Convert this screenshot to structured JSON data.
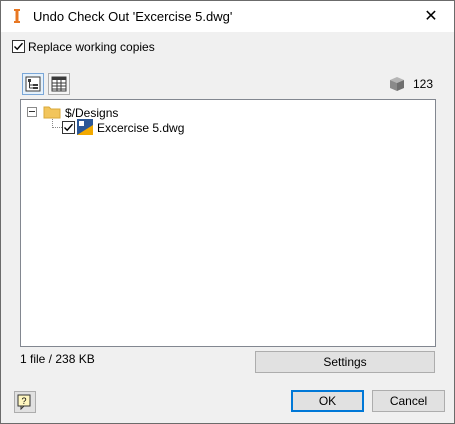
{
  "window": {
    "title": "Undo Check Out 'Excercise 5.dwg'",
    "app_icon": "inventor-vault-icon",
    "close_glyph": "✕"
  },
  "options": {
    "replace_working_copies": {
      "label": "Replace working copies",
      "checked": true
    }
  },
  "toolbar": {
    "tree_view_icon": "tree-view-icon",
    "grid_view_icon": "grid-view-icon",
    "cube_icon": "cube-icon",
    "count": "123"
  },
  "tree": {
    "root": {
      "label": "$/Designs",
      "icon": "folder-icon",
      "expander": "⊟"
    },
    "children": [
      {
        "label": "Excercise 5.dwg",
        "icon": "dwg-file-icon",
        "checked": true
      }
    ]
  },
  "status": {
    "summary": "1 file / 238 KB"
  },
  "buttons": {
    "settings": "Settings",
    "ok": "OK",
    "cancel": "Cancel",
    "help_icon": "help-icon"
  },
  "colors": {
    "accent": "#0078d7",
    "folder": "#f2c55c"
  }
}
